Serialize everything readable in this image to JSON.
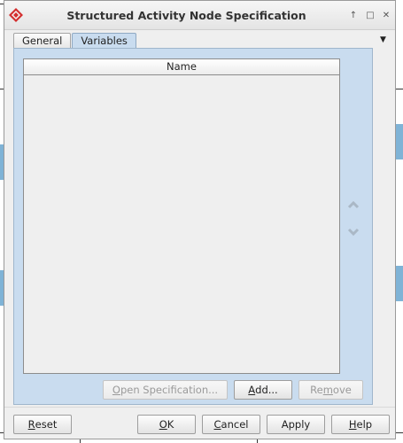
{
  "window": {
    "title": "Structured Activity Node Specification",
    "controls": {
      "minimize_glyph": "↑",
      "maximize_glyph": "□",
      "close_glyph": "✕"
    }
  },
  "tabs": [
    {
      "label": "General",
      "active": false
    },
    {
      "label": "Variables",
      "active": true
    }
  ],
  "tab_menu_glyph": "▼",
  "variables_table": {
    "columns": [
      "Name"
    ],
    "rows": []
  },
  "table_buttons": {
    "open_spec": {
      "label_before": "",
      "mnemonic": "O",
      "label_after": "pen Specification...",
      "enabled": false
    },
    "add": {
      "label_before": "",
      "mnemonic": "A",
      "label_after": "dd...",
      "enabled": true
    },
    "remove": {
      "label_before": "Re",
      "mnemonic": "m",
      "label_after": "ove",
      "enabled": false
    }
  },
  "footer_buttons": {
    "reset": {
      "label_before": "",
      "mnemonic": "R",
      "label_after": "eset"
    },
    "ok": {
      "label_before": "",
      "mnemonic": "O",
      "label_after": "K"
    },
    "cancel": {
      "label_before": "",
      "mnemonic": "C",
      "label_after": "ancel"
    },
    "apply": {
      "label_before": "Apply",
      "mnemonic": "",
      "label_after": ""
    },
    "help": {
      "label_before": "",
      "mnemonic": "H",
      "label_after": "elp"
    }
  },
  "icons": {
    "app": "app-logo-icon",
    "move_up": "chevron-up-icon",
    "move_down": "chevron-down-icon"
  },
  "colors": {
    "accent": "#c9dcef",
    "brand": "#d32f2f",
    "disabled_text": "#9a9a9a"
  }
}
